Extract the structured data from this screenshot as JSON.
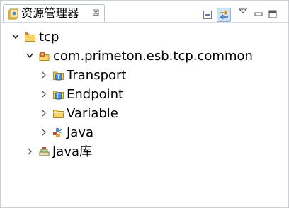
{
  "tab": {
    "title": "资源管理器",
    "close_label": "⊠"
  },
  "toolbar": {
    "collapse_all": "collapse-all-icon",
    "link_with_editor": "link-with-editor-icon",
    "view_menu": "view-menu-icon",
    "minimize": "minimize-icon",
    "maximize": "maximize-icon"
  },
  "tree": {
    "root": {
      "label": "tcp",
      "expanded": true
    },
    "module": {
      "label": "com.primeton.esb.tcp.common",
      "expanded": true
    },
    "children": [
      {
        "label": "Transport",
        "badge": "T",
        "icon": "transport-icon"
      },
      {
        "label": "Endpoint",
        "badge": "E",
        "icon": "endpoint-icon"
      },
      {
        "label": "Variable",
        "icon": "folder-icon"
      },
      {
        "label": "Java",
        "icon": "java-package-icon"
      }
    ],
    "library": {
      "label": "Java库",
      "icon": "java-library-icon"
    }
  },
  "colors": {
    "folder": "#f2c94c",
    "badge_blue": "#4a8fd6",
    "accent": "#3b6fb6"
  }
}
